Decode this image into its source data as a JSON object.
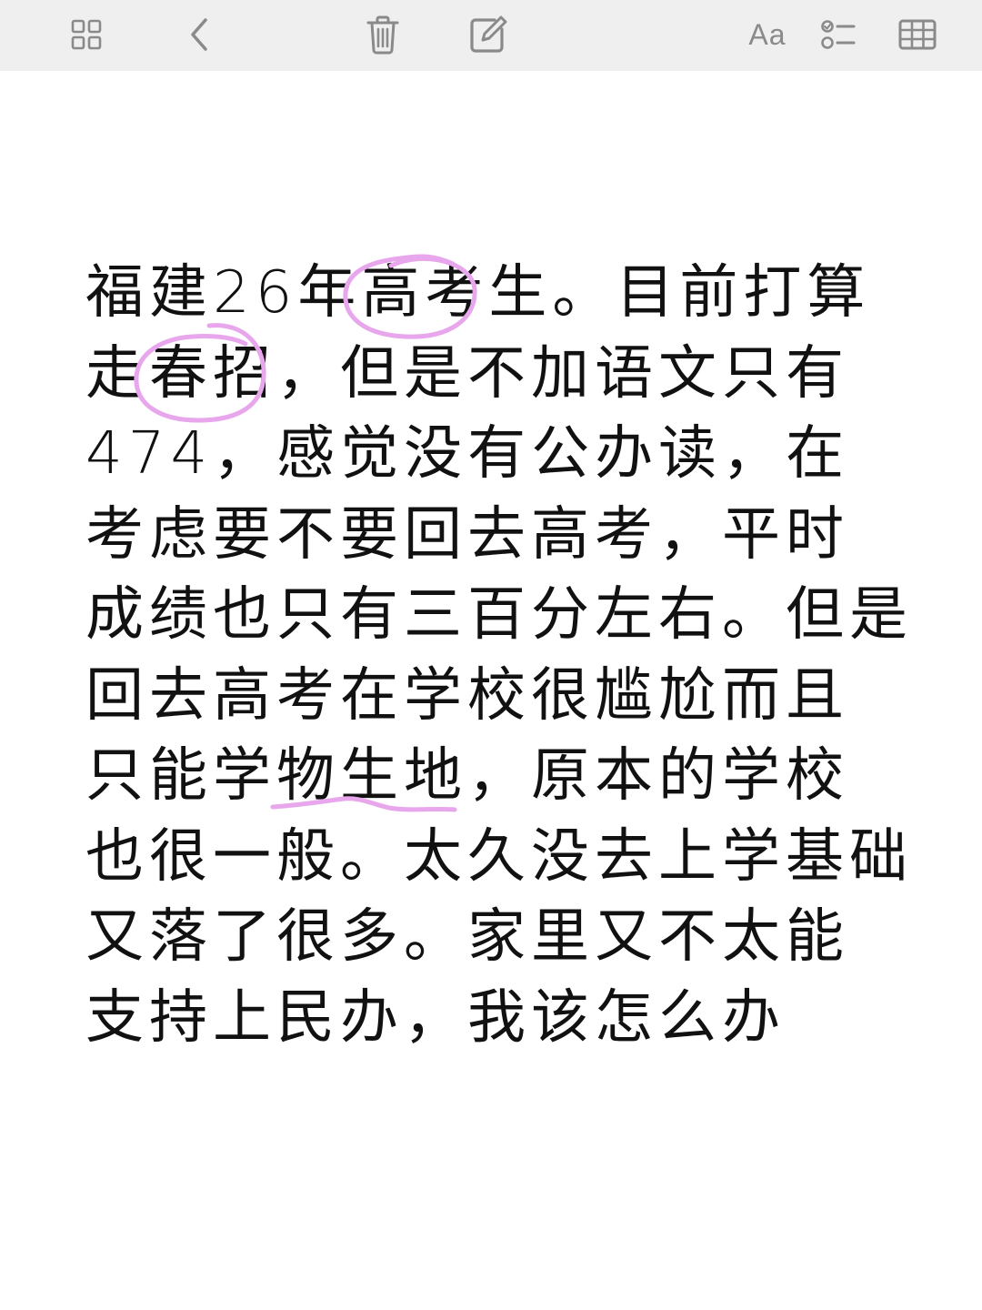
{
  "toolbar": {
    "accent_color": "#8a8a8a",
    "buttons": [
      {
        "name": "gallery-view-button",
        "icon": "grid-icon"
      },
      {
        "name": "back-button",
        "icon": "chevron-left-icon"
      },
      {
        "name": "delete-button",
        "icon": "trash-icon"
      },
      {
        "name": "compose-button",
        "icon": "compose-icon"
      },
      {
        "name": "format-button",
        "icon": "text-format-icon",
        "label": "Aa"
      },
      {
        "name": "checklist-button",
        "icon": "checklist-icon"
      },
      {
        "name": "table-button",
        "icon": "table-icon"
      }
    ],
    "format_label": "Aa"
  },
  "note": {
    "lines": [
      "福建26年高考生。目前打算",
      "走春招，但是不加语文只有",
      "474，感觉没有公办读，在",
      "考虑要不要回去高考，平时",
      "成绩也只有三百分左右。但是",
      "回去高考在学校很尴尬而且",
      "只能学物生地，原本的学校",
      "也很一般。太久没去上学基础",
      "又落了很多。家里又不太能",
      "支持上民办，我该怎么办"
    ]
  },
  "annotations": {
    "color": "#e8a6ec",
    "marks": [
      {
        "name": "circle-highlight",
        "target": "高考"
      },
      {
        "name": "circle-highlight",
        "target": "春招"
      },
      {
        "name": "underline-highlight",
        "target": "物生地"
      }
    ]
  }
}
